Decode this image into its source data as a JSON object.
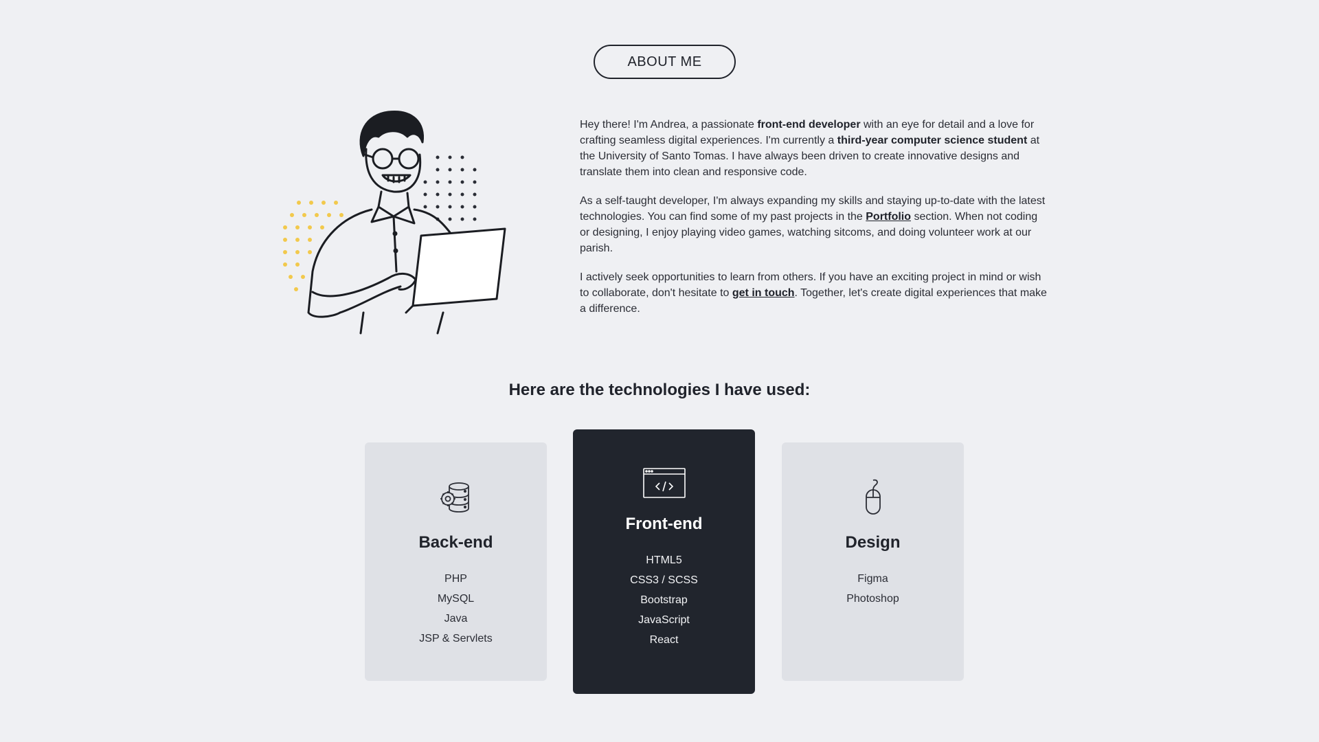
{
  "header": {
    "about_label": "ABOUT ME"
  },
  "bio": {
    "p1": {
      "t1": "Hey there! I'm Andrea, a passionate ",
      "b1": "front-end developer",
      "t2": " with an eye for detail and a love for crafting seamless digital experiences. I'm currently a ",
      "b2": "third-year computer science student",
      "t3": " at the University of Santo Tomas. I have always been driven to create innovative designs and translate them into clean and responsive code."
    },
    "p2": {
      "t1": "As a self-taught developer, I'm always expanding my skills and staying up-to-date with the latest technologies. You can find some of my past projects in the ",
      "link": "Portfolio",
      "t2": " section. When not coding or designing, I enjoy playing video games, watching sitcoms, and doing volunteer work at our parish."
    },
    "p3": {
      "t1": "I actively seek opportunities to learn from others. If you have an exciting project in mind or wish to collaborate, don't hesitate to ",
      "link": "get in touch",
      "t2": ". Together, let's create digital experiences that make a difference."
    }
  },
  "technologies": {
    "heading": "Here are the technologies I have used:",
    "cards": [
      {
        "title": "Back-end",
        "icon": "database-gear-icon",
        "items": [
          "PHP",
          "MySQL",
          "Java",
          "JSP & Servlets"
        ]
      },
      {
        "title": "Front-end",
        "icon": "code-window-icon",
        "items": [
          "HTML5",
          "CSS3 / SCSS",
          "Bootstrap",
          "JavaScript",
          "React"
        ]
      },
      {
        "title": "Design",
        "icon": "mouse-icon",
        "items": [
          "Figma",
          "Photoshop"
        ]
      }
    ]
  },
  "colors": {
    "background": "#eff0f3",
    "dark": "#21252d",
    "card_light": "#dfe1e6",
    "accent_dots": "#f2c94c"
  }
}
